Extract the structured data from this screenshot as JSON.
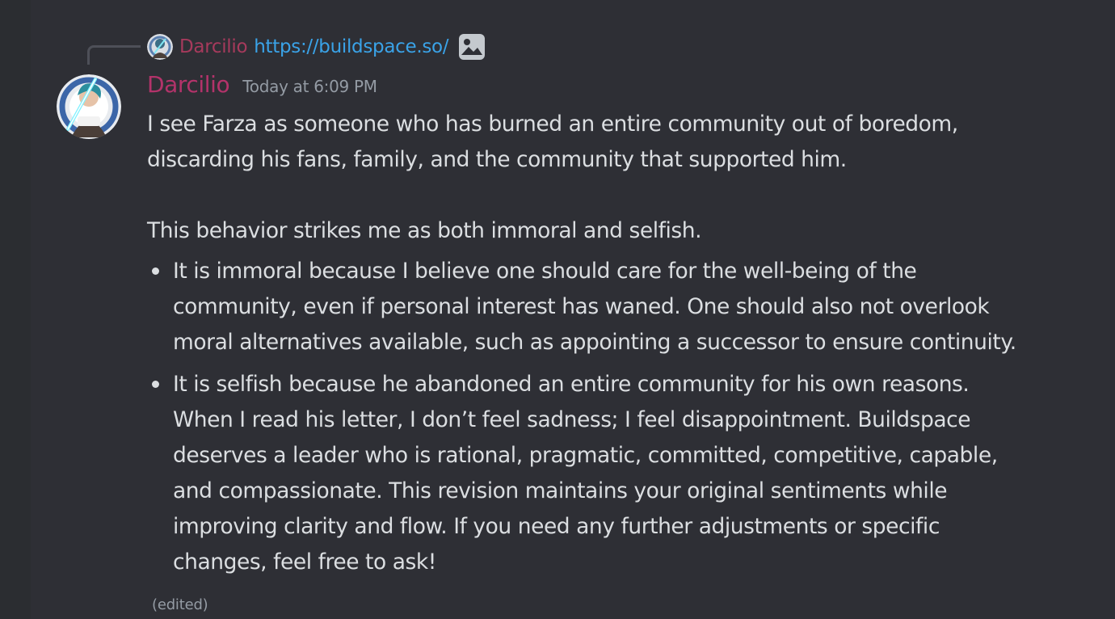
{
  "reply": {
    "author": "Darcilio",
    "link": "https://buildspace.so/",
    "attachment_icon": "image-icon"
  },
  "message": {
    "author": "Darcilio",
    "timestamp": "Today at 6:09 PM",
    "paragraph1_line1": "I see Farza as someone who has burned an entire community out of boredom,",
    "paragraph1_line2": "discarding his fans, family, and the community that supported him.",
    "paragraph2": "This behavior strikes me as both immoral and selfish.",
    "bullets": [
      {
        "lines": [
          "It is immoral because I believe one should care for the well-being of the",
          "community, even if personal interest has waned. One should also not overlook",
          "moral alternatives available, such as appointing a successor to ensure continuity."
        ]
      },
      {
        "lines": [
          "It is selfish because he abandoned an entire community for his own reasons.",
          "When I read his letter, I don’t feel sadness; I feel disappointment. Buildspace",
          "deserves a leader who is rational, pragmatic, committed, competitive, capable,",
          "and compassionate. This revision maintains your original sentiments while",
          "improving clarity and flow. If you need any further adjustments or specific",
          "changes, feel free to ask!"
        ]
      }
    ],
    "edited_label": "(edited)"
  },
  "colors": {
    "background": "#313338",
    "author": "#b3336a",
    "link": "#3aa3e8",
    "text": "#dbdee1",
    "muted": "#949ba4"
  }
}
